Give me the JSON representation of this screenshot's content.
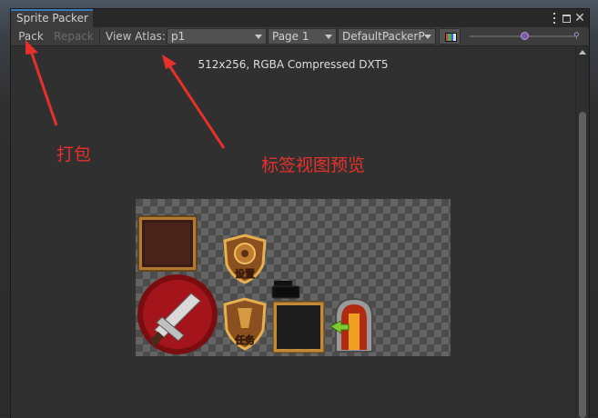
{
  "window": {
    "tab_title": "Sprite Packer"
  },
  "toolbar": {
    "pack_label": "Pack",
    "repack_label": "Repack",
    "view_atlas_label": "View Atlas:",
    "atlas_value": "p1",
    "page_value": "Page 1",
    "packer_value": "DefaultPackerP"
  },
  "preview": {
    "info": "512x256, RGBA Compressed DXT5",
    "sprite_settings_text": "设置",
    "sprite_quest_text": "任务"
  },
  "annotations": {
    "pack": "打包",
    "preview": "标签视图预览",
    "color": "#e8302a"
  },
  "icons": [
    "kebab-menu-icon",
    "maximize-icon",
    "close-icon",
    "color-channel-icon",
    "zoom-slider-icon",
    "zoom-max-icon",
    "scroll-up-icon"
  ]
}
